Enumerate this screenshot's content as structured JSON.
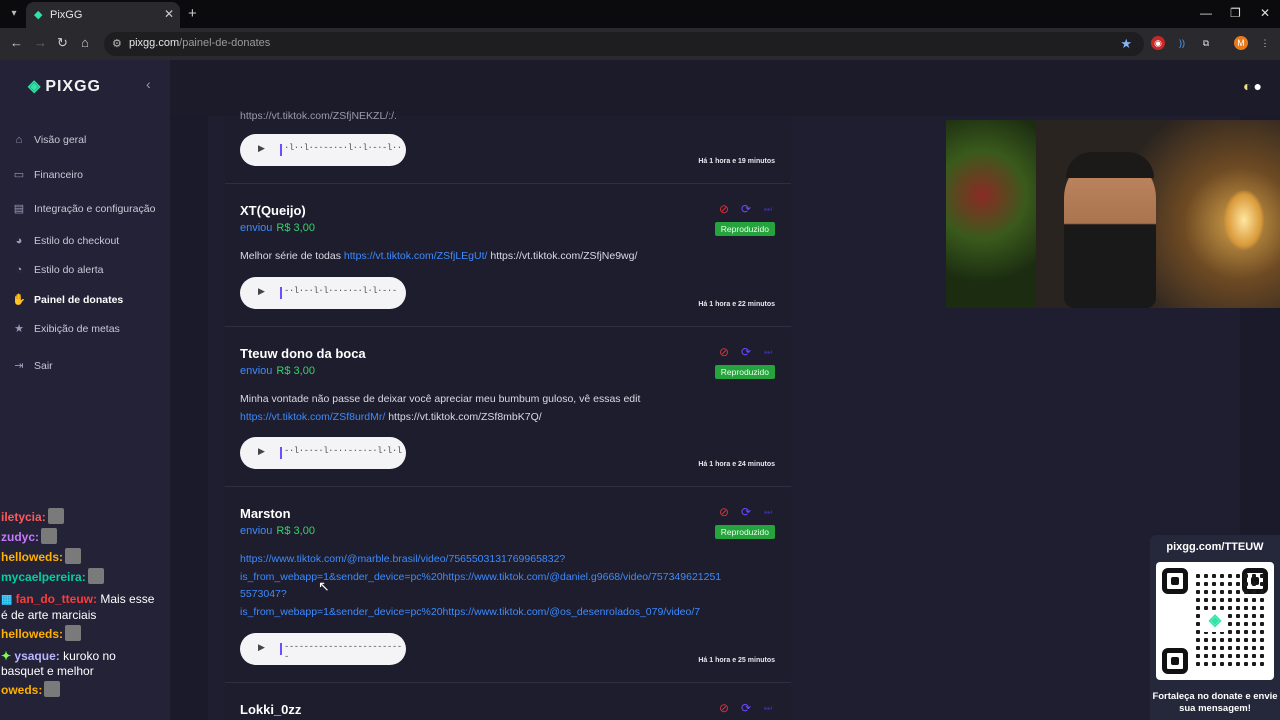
{
  "browser": {
    "tab_title": "PixGG",
    "url_domain": "pixgg.com",
    "url_path": "/painel-de-donates",
    "profile_initial": "M"
  },
  "sidebar": {
    "logo": "PIXGG",
    "items": [
      {
        "label": "Visão geral",
        "icon": "home-icon"
      },
      {
        "label": "Financeiro",
        "icon": "wallet-icon"
      },
      {
        "label": "Integração e configuração",
        "icon": "settings-icon"
      },
      {
        "label": "Estilo do checkout",
        "icon": "palette-icon"
      },
      {
        "label": "Estilo do alerta",
        "icon": "bell-icon"
      },
      {
        "label": "Painel de donates",
        "icon": "donate-icon"
      },
      {
        "label": "Exibição de metas",
        "icon": "star-icon"
      },
      {
        "label": "Sair",
        "icon": "logout-icon"
      }
    ],
    "active_item": "Painel de donates"
  },
  "donations": [
    {
      "partial_message": "https://vt.tiktok.com/ZSfjNEKZL/:/.",
      "time": "Há 1 hora e 19 minutos",
      "wave": "·l··l·-·--·-·l··l·-·-l··"
    },
    {
      "name": "XT(Queijo)",
      "sent_label": "enviou",
      "amount": "R$ 3,00",
      "status": "Reproduzido",
      "message_text": "Melhor série de todas ",
      "message_link": "https://vt.tiktok.com/ZSfjLEgUt/",
      "message_tail": " https://vt.tiktok.com/ZSfjNe9wg/",
      "time": "Há 1 hora e 22 minutos",
      "wave": "-·l·-·l·l·-·-·-·l·l·-·-"
    },
    {
      "name": "Tteuw dono da boca",
      "sent_label": "enviou",
      "amount": "R$ 3,00",
      "status": "Reproduzido",
      "message_text": "Minha vontade não passe de deixar você apreciar meu bumbum guloso, vê essas edit ",
      "message_link": "https://vt.tiktok.com/ZSf8urdMr/",
      "message_tail": " https://vt.tiktok.com/ZSf8mbK7Q/",
      "time": "Há 1 hora e 24 minutos",
      "wave": "-·l·-·-·l·-··-·-·-·l·l·l"
    },
    {
      "name": "Marston",
      "sent_label": "enviou",
      "amount": "R$ 3,00",
      "status": "Reproduzido",
      "message_link_lines": [
        "https://www.tiktok.com/@marble.brasil/video/7565503131769965832?",
        "is_from_webapp=1&sender_device=pc%20https://www.tiktok.com/@daniel.g9668/video/757349621251",
        "5573047?",
        "is_from_webapp=1&sender_device=pc%20https://www.tiktok.com/@os_desenrolados_079/video/7"
      ],
      "time": "Há 1 hora e 25 minutos",
      "wave": "-------------------------"
    },
    {
      "name": "Lokki_0zz"
    }
  ],
  "chat": [
    {
      "user": "iletycia:",
      "color": "#ff5a5a",
      "text": ""
    },
    {
      "user": "zudyc:",
      "color": "#c678ff",
      "text": ""
    },
    {
      "user": "helloweds:",
      "color": "#ffb000",
      "text": ""
    },
    {
      "user": "mycaelpereira:",
      "color": "#00d1a0",
      "text": ""
    },
    {
      "user": "fan_do_tteuw:",
      "color": "#ff3b3b",
      "text": "Mais esse"
    },
    {
      "user": "",
      "color": "#ffffff",
      "text": "é de arte marciais"
    },
    {
      "user": "helloweds:",
      "color": "#ffb000",
      "text": ""
    },
    {
      "user": "ysaque:",
      "color": "#b9b6ff",
      "text": "kuroko no"
    },
    {
      "user": "",
      "color": "#ffffff",
      "text": "basquet e melhor"
    },
    {
      "user": "oweds:",
      "color": "#ffb000",
      "text": ""
    }
  ],
  "overlay": {
    "qr_url": "pixgg.com/TTEUW",
    "qr_caption": "Fortaleça no donate e envie sua mensagem!"
  }
}
